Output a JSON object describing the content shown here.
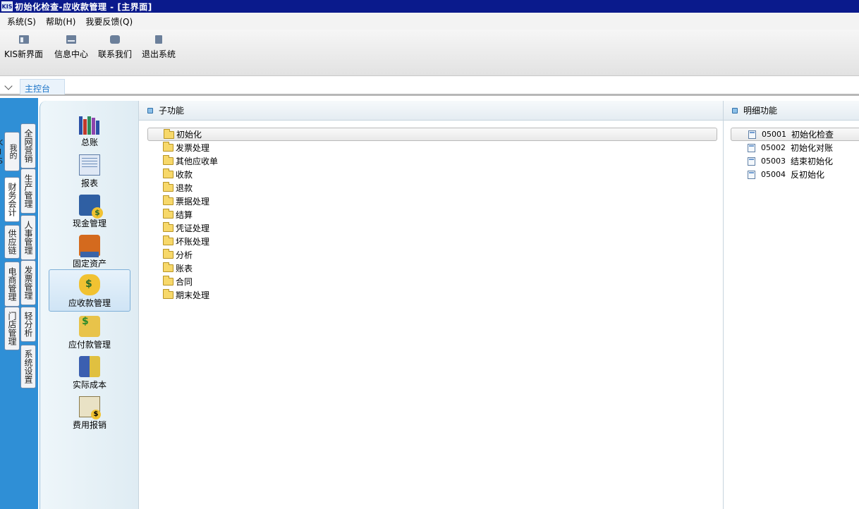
{
  "window": {
    "title": "初始化检查-应收款管理 - [主界面]",
    "app_badge": "KIS"
  },
  "menubar": [
    {
      "label": "系统(S)"
    },
    {
      "label": "帮助(H)"
    },
    {
      "label": "我要反馈(Q)"
    }
  ],
  "toolbar": [
    {
      "label": "KIS新界面",
      "icon": "layout-icon"
    },
    {
      "label": "信息中心",
      "icon": "mail-icon"
    },
    {
      "label": "联系我们",
      "icon": "chat-icon"
    },
    {
      "label": "退出系统",
      "icon": "exit-icon"
    }
  ],
  "tabs": [
    {
      "label": "主控台"
    }
  ],
  "left_tabs_col1": [
    "我的KIS",
    "财务会计",
    "供应链",
    "电商管理",
    "门店管理"
  ],
  "left_tabs_col2": [
    "全网营销",
    "生产管理",
    "人事管理",
    "发票管理",
    "轻分析",
    "系统设置"
  ],
  "modules": [
    {
      "label": "总账"
    },
    {
      "label": "报表"
    },
    {
      "label": "现金管理"
    },
    {
      "label": "固定资产"
    },
    {
      "label": "应收款管理"
    },
    {
      "label": "应付款管理"
    },
    {
      "label": "实际成本"
    },
    {
      "label": "费用报销"
    }
  ],
  "sub_panel": {
    "title": "子功能",
    "items": [
      "初始化",
      "发票处理",
      "其他应收单",
      "收款",
      "退款",
      "票据处理",
      "结算",
      "凭证处理",
      "坏账处理",
      "分析",
      "账表",
      "合同",
      "期末处理"
    ]
  },
  "detail_panel": {
    "title": "明细功能",
    "items": [
      {
        "code": "05001",
        "label": "初始化检查"
      },
      {
        "code": "05002",
        "label": "初始化对账"
      },
      {
        "code": "05003",
        "label": "结束初始化"
      },
      {
        "code": "05004",
        "label": "反初始化"
      }
    ]
  }
}
